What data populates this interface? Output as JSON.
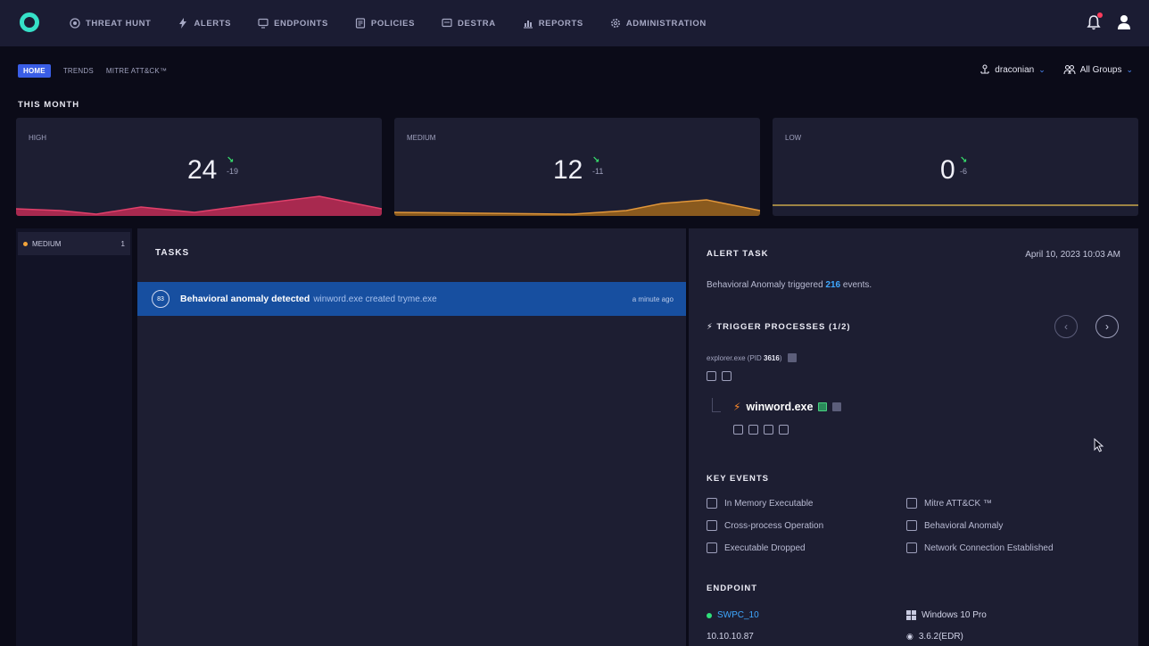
{
  "nav": {
    "items": [
      {
        "label": "THREAT HUNT",
        "icon": "target-icon"
      },
      {
        "label": "ALERTS",
        "icon": "bolt-icon"
      },
      {
        "label": "ENDPOINTS",
        "icon": "monitor-icon"
      },
      {
        "label": "POLICIES",
        "icon": "policy-icon"
      },
      {
        "label": "DESTRA",
        "icon": "destra-icon"
      },
      {
        "label": "REPORTS",
        "icon": "chart-icon"
      },
      {
        "label": "ADMINISTRATION",
        "icon": "gear-icon"
      }
    ]
  },
  "subnav": {
    "home": "HOME",
    "trends": "TRENDS",
    "mitre": "MITRE ATT&CK™"
  },
  "filters": {
    "user": "draconian",
    "groups": "All Groups"
  },
  "this_month": "THIS MONTH",
  "cards": {
    "high": {
      "label": "HIGH",
      "value": "24",
      "delta": "-19",
      "color": "#d6365e"
    },
    "medium": {
      "label": "MEDIUM",
      "value": "12",
      "delta": "-11",
      "color": "#e0963a"
    },
    "low": {
      "label": "LOW",
      "value": "0",
      "delta": "-6",
      "color": "#c9a64a"
    }
  },
  "filter_panel": {
    "severity": "MEDIUM",
    "count": "1"
  },
  "tasks": {
    "title": "TASKS",
    "row": {
      "score": "83",
      "title": "Behavioral anomaly detected",
      "detail": "winword.exe created tryme.exe",
      "time": "a minute ago"
    }
  },
  "alert": {
    "title": "ALERT TASK",
    "date": "April 10, 2023 10:03 AM",
    "summary_prefix": "Behavioral Anomaly triggered ",
    "summary_count": "216",
    "summary_suffix": " events.",
    "trigger_title": "TRIGGER PROCESSES (1/2)",
    "parent_name": "explorer.exe (PID ",
    "parent_pid": "3616",
    "parent_close": ")",
    "child_name": "winword.exe",
    "key_events_title": "KEY EVENTS",
    "key_events_left": [
      "In Memory Executable",
      "Cross-process Operation",
      "Executable Dropped"
    ],
    "key_events_right": [
      "Mitre ATT&CK ™",
      "Behavioral Anomaly",
      "Network Connection Established"
    ],
    "endpoint_title": "ENDPOINT",
    "endpoint_name": "SWPC_10",
    "endpoint_os": "Windows 10 Pro",
    "endpoint_ip": "10.10.10.87",
    "endpoint_version": "3.6.2(EDR)"
  }
}
